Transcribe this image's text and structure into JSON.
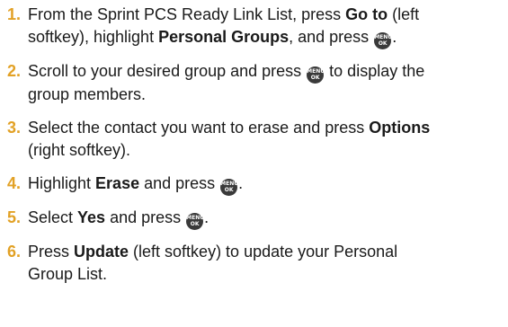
{
  "steps": [
    {
      "number": "1.",
      "lines": [
        [
          "From the Sprint PCS Ready Link List, press ",
          {
            "bold": "Go to"
          },
          " (left"
        ],
        [
          "softkey), highlight ",
          {
            "bold": "Personal Groups"
          },
          ", and press ",
          {
            "icon": "menu-ok-key"
          },
          "."
        ]
      ]
    },
    {
      "number": "2.",
      "lines": [
        [
          "Scroll to your desired group and press ",
          {
            "icon": "menu-ok-key"
          },
          " to display the"
        ],
        [
          "group members."
        ]
      ]
    },
    {
      "number": "3.",
      "lines": [
        [
          "Select the contact you want to erase and press ",
          {
            "bold": "Options"
          }
        ],
        [
          "(right softkey)."
        ]
      ]
    },
    {
      "number": "4.",
      "lines": [
        [
          "Highlight ",
          {
            "bold": "Erase"
          },
          " and press ",
          {
            "icon": "menu-ok-key"
          },
          "."
        ]
      ]
    },
    {
      "number": "5.",
      "lines": [
        [
          "Select ",
          {
            "bold": "Yes"
          },
          " and press ",
          {
            "icon": "menu-ok-key"
          },
          "."
        ]
      ]
    },
    {
      "number": "6.",
      "lines": [
        [
          "Press ",
          {
            "bold": "Update"
          },
          " (left softkey) to update your Personal"
        ],
        [
          "Group List."
        ]
      ]
    }
  ],
  "key_icon": {
    "top_label": "MENU",
    "bottom_label": "OK"
  },
  "colors": {
    "step_number": "#e2a125",
    "key_icon_bg": "#3a3a3a",
    "text": "#1a1a1a"
  }
}
